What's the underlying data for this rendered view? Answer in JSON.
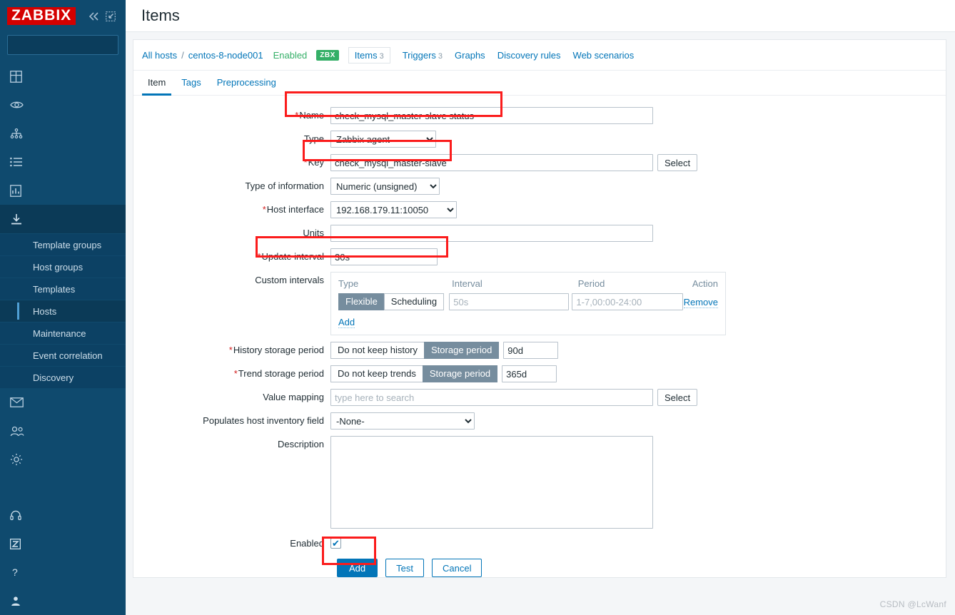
{
  "sidebar": {
    "logo": "ZABBIX",
    "collapse_icon": "chevron-double-left-icon",
    "compact_icon": "collapse-view-icon",
    "search": {
      "value": "",
      "placeholder": ""
    },
    "items": [
      {
        "label": "Dashboards",
        "icon": "dashboard-icon",
        "chevron": ""
      },
      {
        "label": "Monitoring",
        "icon": "eye-icon",
        "chevron": "⌄"
      },
      {
        "label": "Services",
        "icon": "services-tree-icon",
        "chevron": "⌄"
      },
      {
        "label": "Inventory",
        "icon": "list-icon",
        "chevron": "⌄"
      },
      {
        "label": "Reports",
        "icon": "report-bar-icon",
        "chevron": "⌄"
      },
      {
        "label": "Data collection",
        "icon": "download-icon",
        "chevron": "⌃"
      }
    ],
    "data_collection_sub": [
      "Template groups",
      "Host groups",
      "Templates",
      "Hosts",
      "Maintenance",
      "Event correlation",
      "Discovery"
    ],
    "data_collection_selected": "Hosts",
    "items_after": [
      {
        "label": "Alerts",
        "icon": "envelope-icon",
        "chevron": "⌄"
      },
      {
        "label": "Users",
        "icon": "users-icon",
        "chevron": "⌄"
      },
      {
        "label": "Administration",
        "icon": "gear-icon",
        "chevron": "⌄"
      }
    ],
    "bottom_items": [
      {
        "label": "Support",
        "icon": "headset-icon",
        "chevron": ""
      },
      {
        "label": "Integrations",
        "icon": "zabbix-z-icon",
        "chevron": ""
      },
      {
        "label": "Help",
        "icon": "question-icon",
        "chevron": ""
      },
      {
        "label": "User settings",
        "icon": "person-icon",
        "chevron": "⌄"
      }
    ]
  },
  "header": {
    "title": "Items"
  },
  "breadcrumb": {
    "all_hosts": "All hosts",
    "separator": "/",
    "host": "centos-8-node001",
    "status": "Enabled",
    "agent_badge": "ZBX",
    "items_tab": "Items",
    "items_count": "3",
    "triggers": "Triggers",
    "triggers_count": "3",
    "graphs": "Graphs",
    "discovery_rules": "Discovery rules",
    "web_scenarios": "Web scenarios"
  },
  "tabs": [
    {
      "label": "Item",
      "active": true
    },
    {
      "label": "Tags",
      "active": false
    },
    {
      "label": "Preprocessing",
      "active": false
    }
  ],
  "form": {
    "name": {
      "label": "Name",
      "required": "*",
      "value": "check_mysql_master-slave status"
    },
    "type": {
      "label": "Type",
      "value": "Zabbix agent"
    },
    "key": {
      "label": "Key",
      "required": "*",
      "value": "check_mysql_master-slave",
      "select_label": "Select"
    },
    "type_of_information": {
      "label": "Type of information",
      "value": "Numeric (unsigned)"
    },
    "host_interface": {
      "label": "Host interface",
      "required": "*",
      "value": "192.168.179.11:10050"
    },
    "units": {
      "label": "Units",
      "value": ""
    },
    "update_interval": {
      "label": "Update interval",
      "required": "*",
      "value": "30s"
    },
    "custom_intervals": {
      "label": "Custom intervals",
      "headers": [
        "Type",
        "Interval",
        "Period",
        "Action"
      ],
      "rows": [
        {
          "type_options": [
            "Flexible",
            "Scheduling"
          ],
          "type_selected": "Flexible",
          "interval_value": "",
          "interval_placeholder": "50s",
          "period_value": "",
          "period_placeholder": "1-7,00:00-24:00",
          "action": "Remove"
        }
      ],
      "add_label": "Add"
    },
    "history_storage_period": {
      "label": "History storage period",
      "required": "*",
      "options": [
        "Do not keep history",
        "Storage period"
      ],
      "selected": "Storage period",
      "value": "90d"
    },
    "trend_storage_period": {
      "label": "Trend storage period",
      "required": "*",
      "options": [
        "Do not keep trends",
        "Storage period"
      ],
      "selected": "Storage period",
      "value": "365d"
    },
    "value_mapping": {
      "label": "Value mapping",
      "value": "",
      "placeholder": "type here to search",
      "select_label": "Select"
    },
    "populates_host_inventory_field": {
      "label": "Populates host inventory field",
      "value": "-None-"
    },
    "description": {
      "label": "Description",
      "value": "",
      "placeholder": ""
    },
    "enabled": {
      "label": "Enabled",
      "checked": true,
      "glyph": "✔"
    }
  },
  "buttons": {
    "add": "Add",
    "test": "Test",
    "cancel": "Cancel"
  },
  "colors": {
    "sidebar_bg": "#0f4a6e",
    "logo_red": "#d40000",
    "accent_blue": "#0275b8",
    "green": "#34af67",
    "highlight_red": "#fb1c1c",
    "required_red": "#d31f1f",
    "segment_on": "#768d9e"
  },
  "watermark": "CSDN @LcWanf"
}
